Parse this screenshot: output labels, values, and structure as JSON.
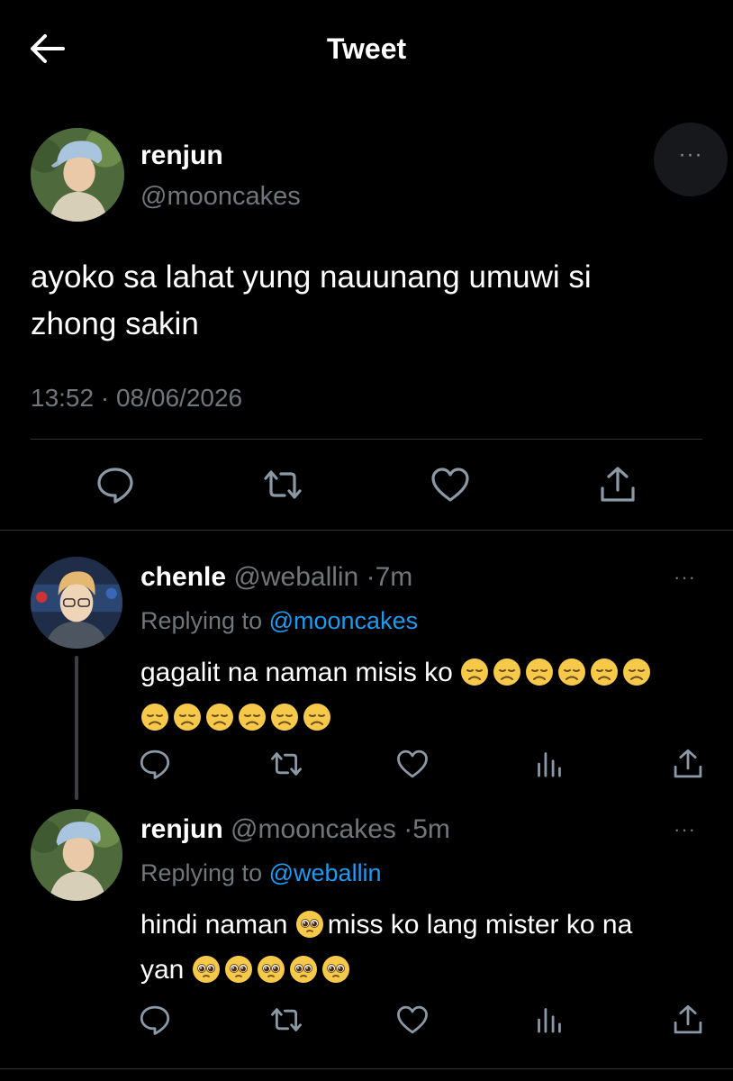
{
  "header": {
    "title": "Tweet"
  },
  "tweet": {
    "name": "renjun",
    "handle": "@mooncakes",
    "text_line1": "ayoko sa lahat yung nauunang umuwi si",
    "text_line2": "zhong sakin",
    "time": "13:52",
    "date": "08/06/2026",
    "separator": "·",
    "more": "···"
  },
  "replies": [
    {
      "name": "chenle",
      "handle": "@weballin",
      "age": "7m",
      "replying_prefix": "Replying to",
      "replying_to": "@mooncakes",
      "text_line1": "gagalit na naman misis ko",
      "text_line1_emoji": "disappointed-face",
      "text_line1_emoji_count": 6,
      "text_line2_emoji_count": 6,
      "more": "···"
    },
    {
      "name": "renjun",
      "handle": "@mooncakes",
      "age": "5m",
      "replying_prefix": "Replying to",
      "replying_to": "@weballin",
      "text_part1": "hindi naman",
      "text_part2": "miss ko lang mister ko na",
      "text_line2": "yan",
      "emoji": "pleading-face",
      "text_line2_emoji_count": 5,
      "more": "···"
    }
  ],
  "colors": {
    "background": "#000000",
    "text": "#e7e9ea",
    "secondary": "#71767b",
    "link": "#1d9bf0",
    "divider": "#2f3336"
  }
}
